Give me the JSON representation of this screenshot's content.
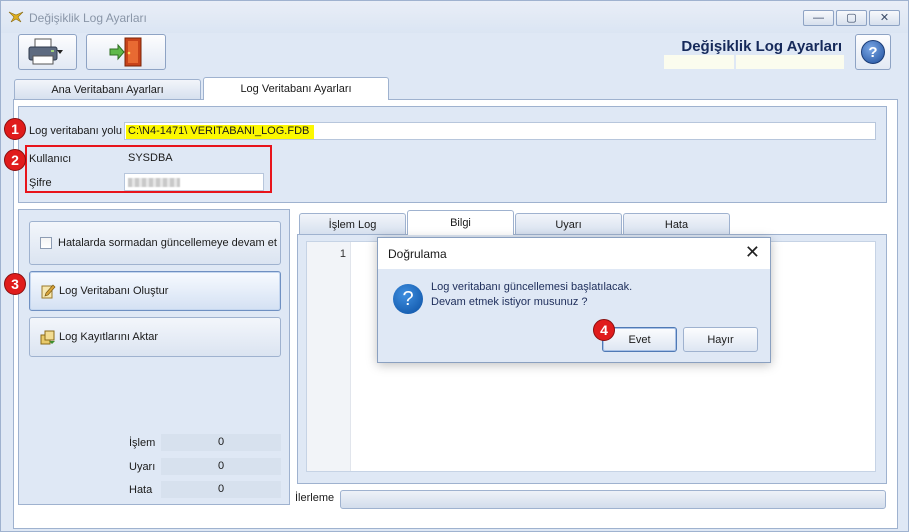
{
  "window": {
    "title": "Değişiklik Log Ayarları",
    "minimize_glyph": "—",
    "maximize_glyph": "▢",
    "close_glyph": "✕"
  },
  "toolbar": {
    "print_icon": "printer-icon",
    "exit_icon": "exit-door-icon",
    "header_title": "Değişiklik Log Ayarları",
    "help_glyph": "?"
  },
  "tabs": [
    {
      "label": "Ana Veritabanı Ayarları",
      "active": false
    },
    {
      "label": "Log Veritabanı Ayarları",
      "active": true
    }
  ],
  "log_settings": {
    "path_label": "Log veritabanı yolu",
    "path_value": "C:\\N4-1471\\ VERITABANI_LOG.FDB",
    "user_label": "Kullanıcı",
    "user_value": "SYSDBA",
    "password_label": "Şifre"
  },
  "markers": [
    "1",
    "2",
    "3",
    "4"
  ],
  "actions": {
    "checkbox_label": "Hatalarda sormadan güncellemeye devam et",
    "create_label": "Log Veritabanı Oluştur",
    "transfer_label": "Log Kayıtlarını Aktar"
  },
  "stats": [
    {
      "label": "İşlem",
      "value": "0"
    },
    {
      "label": "Uyarı",
      "value": "0"
    },
    {
      "label": "Hata",
      "value": "0"
    }
  ],
  "sub_tabs": [
    {
      "label": "İşlem Log",
      "active": false
    },
    {
      "label": "Bilgi",
      "active": true
    },
    {
      "label": "Uyarı",
      "active": false
    },
    {
      "label": "Hata",
      "active": false
    }
  ],
  "editor": {
    "line_number": "1"
  },
  "progress": {
    "label": "İlerleme",
    "percent": 0
  },
  "dialog": {
    "title": "Doğrulama",
    "close_glyph": "✕",
    "message_line1": "Log veritabanı güncellemesi başlatılacak.",
    "message_line2": "Devam etmek istiyor musunuz ?",
    "yes_label": "Evet",
    "no_label": "Hayır",
    "question_glyph": "?"
  },
  "colors": {
    "marker": "#e01c1c",
    "highlight": "#fcf800",
    "accent": "#15295a"
  }
}
